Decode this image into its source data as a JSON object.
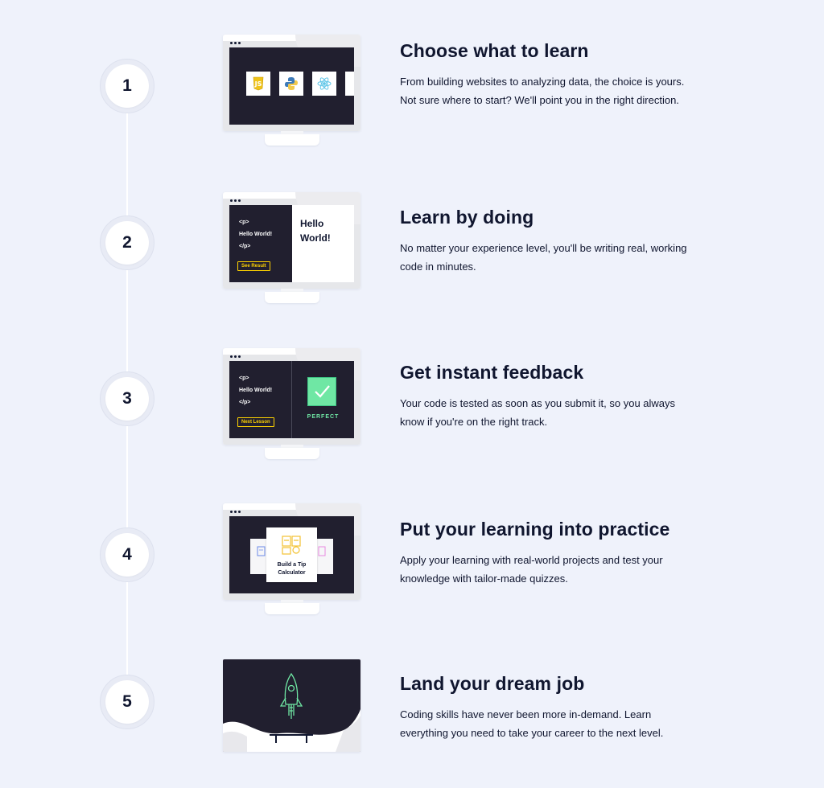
{
  "steps": [
    {
      "number": "1",
      "title": "Choose what to learn",
      "description": "From building websites to analyzing data, the choice is yours. Not sure where to start? We'll point you in the right direction.",
      "tiles": [
        "js-logo-icon",
        "python-logo-icon",
        "react-logo-icon"
      ]
    },
    {
      "number": "2",
      "title": "Learn by doing",
      "description": "No matter your experience level, you'll be writing real, working code in minutes.",
      "code": [
        "<p>",
        "Hello World!",
        "</p>"
      ],
      "button": "See Result",
      "result": [
        "Hello",
        "World!"
      ]
    },
    {
      "number": "3",
      "title": "Get instant feedback",
      "description": "Your code is tested as soon as you submit it, so you always know if you're on the right track.",
      "code": [
        "<p>",
        "Hello World!",
        "</p>"
      ],
      "button": "Next Lesson",
      "status": "PERFECT"
    },
    {
      "number": "4",
      "title": "Put your learning into practice",
      "description": "Apply your learning with real-world projects and test your knowledge with tailor-made quizzes.",
      "project_title": "Build a Tip Calculator"
    },
    {
      "number": "5",
      "title": "Land your dream job",
      "description": "Coding skills have never been more in-demand. Learn everything you need to take your career to the next level."
    }
  ],
  "colors": {
    "background": "#eff2fb",
    "navy": "#10162f",
    "screen": "#211f2f",
    "yellow": "#ffd300",
    "green": "#6fe7a4"
  }
}
